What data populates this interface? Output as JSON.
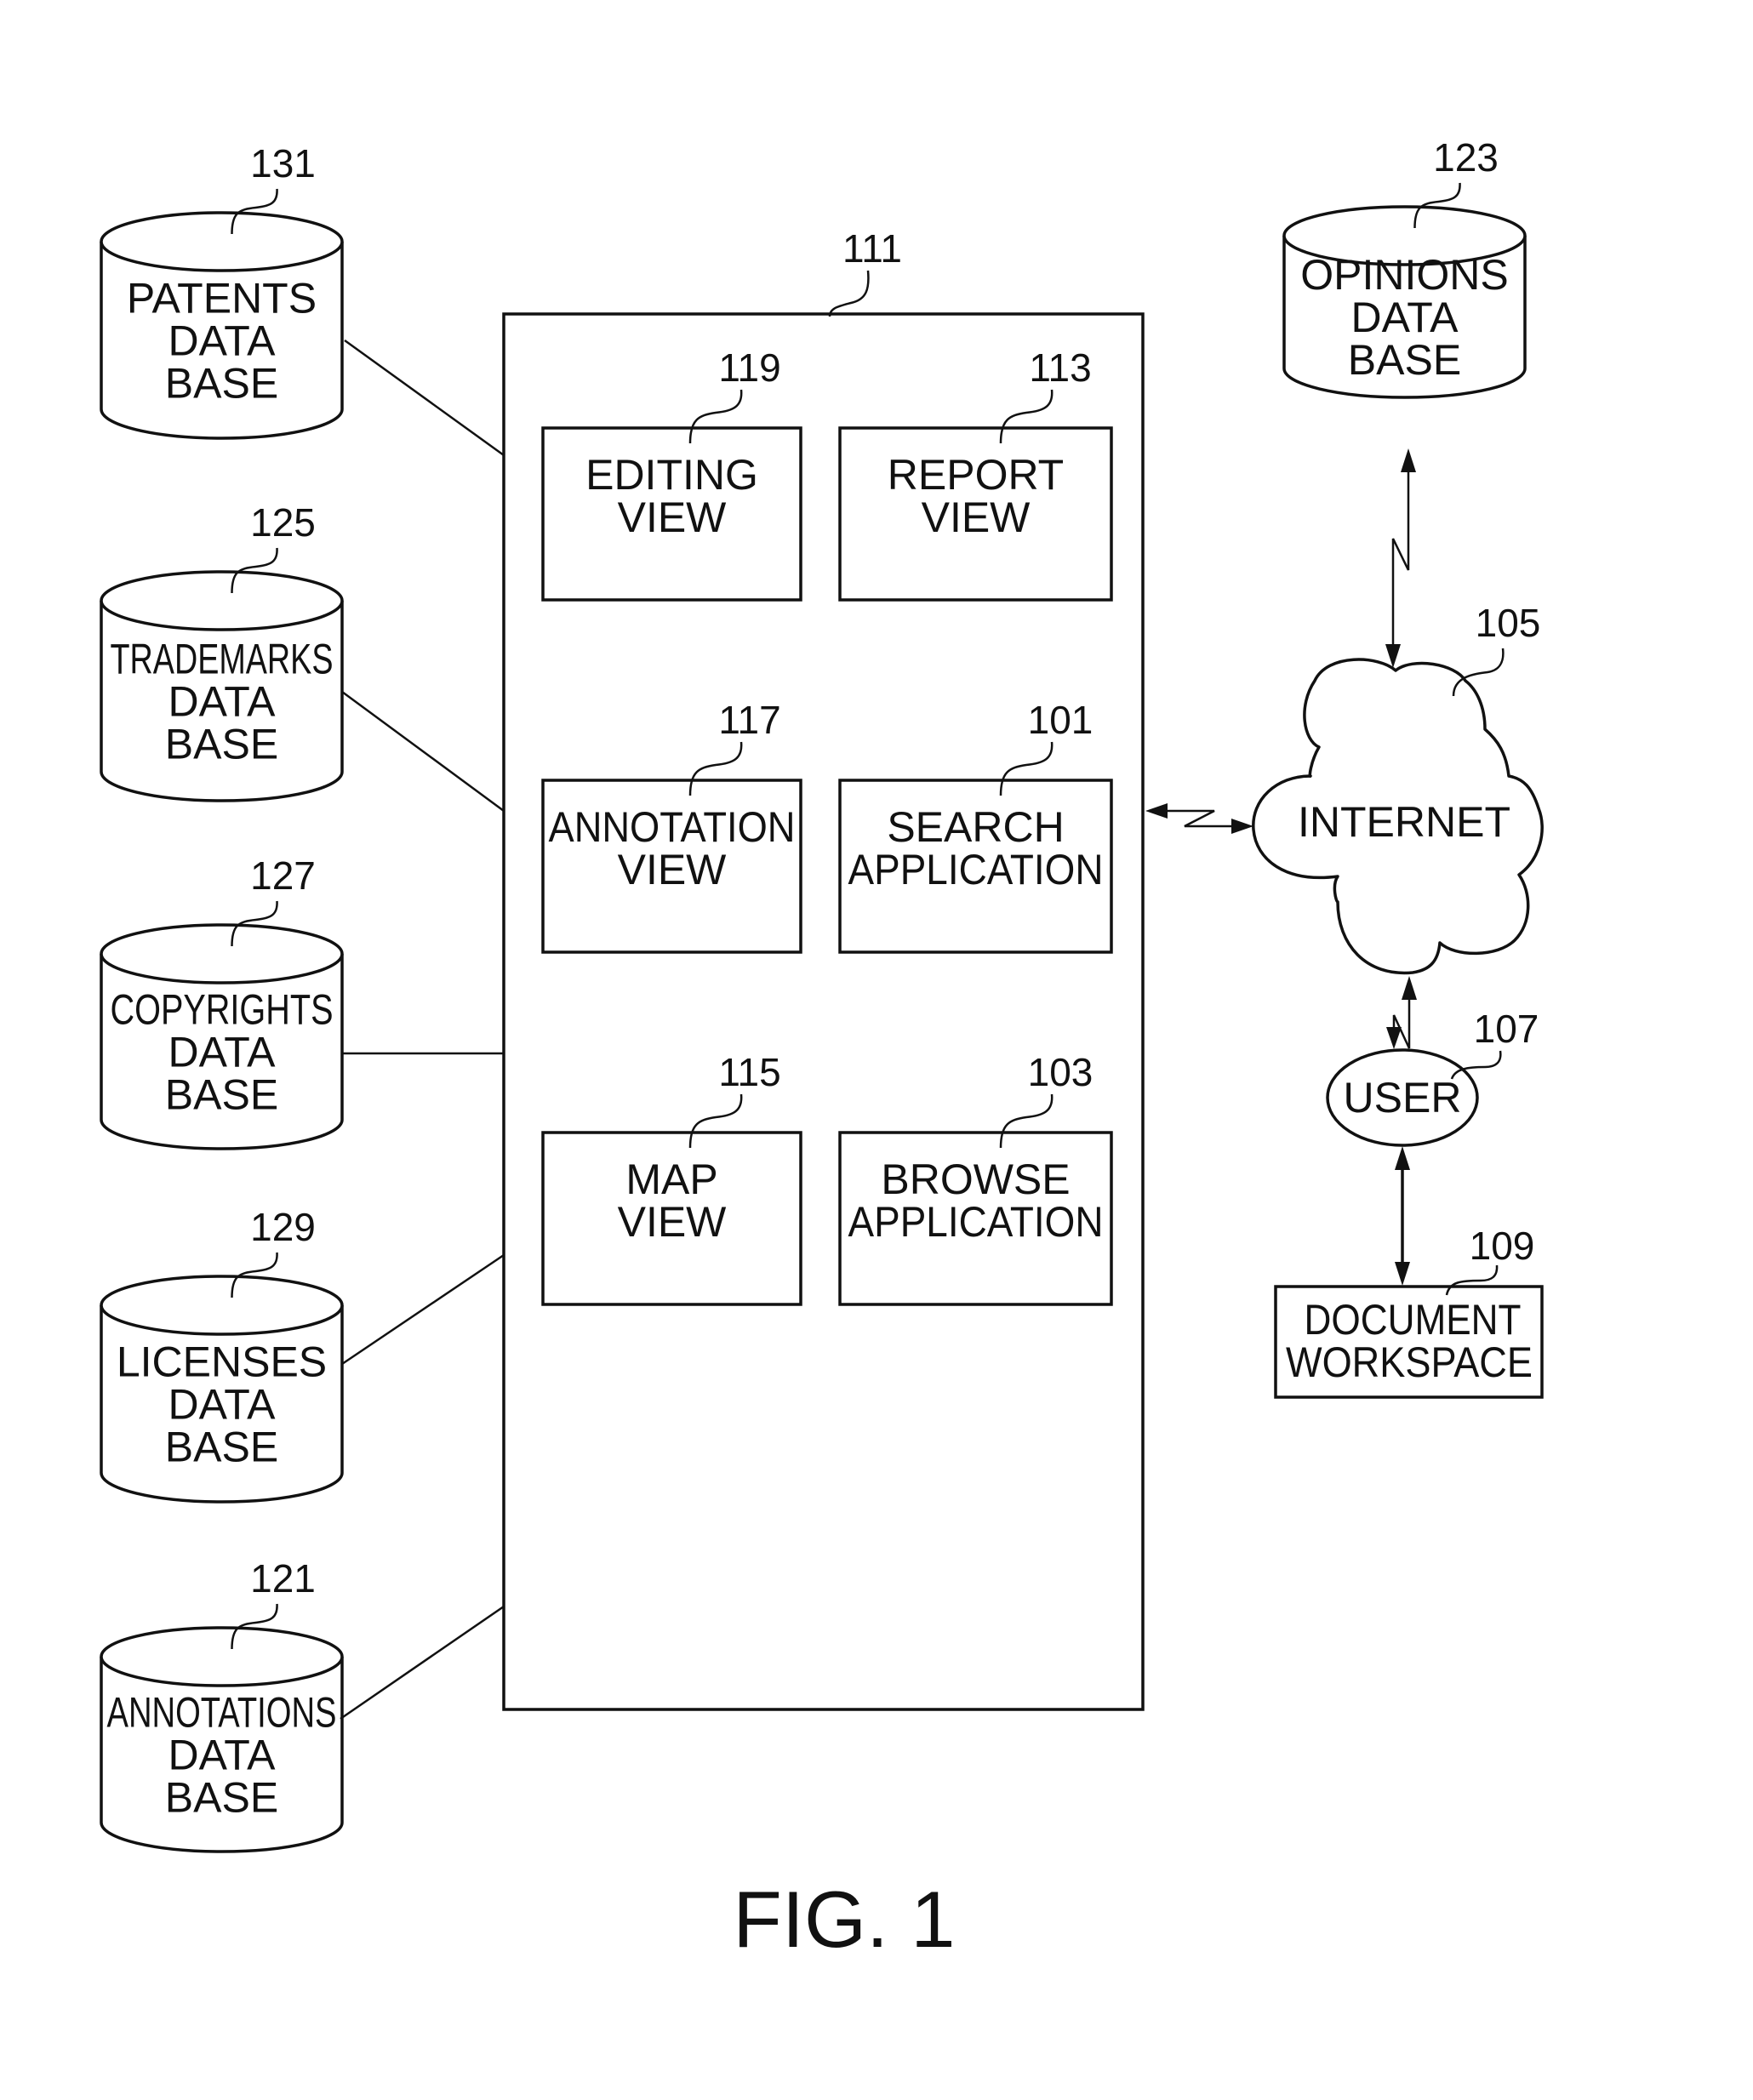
{
  "figure": {
    "caption": "FIG. 1",
    "colors": {
      "ink": "#111111",
      "paper": "#ffffff"
    }
  },
  "main_system": {
    "ref": "111",
    "modules": [
      {
        "id": "editing-view",
        "ref": "119",
        "lines": [
          "EDITING",
          "VIEW"
        ]
      },
      {
        "id": "report-view",
        "ref": "113",
        "lines": [
          "REPORT",
          "VIEW"
        ]
      },
      {
        "id": "annotation-view",
        "ref": "117",
        "lines": [
          "ANNOTATION",
          "VIEW"
        ]
      },
      {
        "id": "search-application",
        "ref": "101",
        "lines": [
          "SEARCH",
          "APPLICATION"
        ]
      },
      {
        "id": "map-view",
        "ref": "115",
        "lines": [
          "MAP",
          "VIEW"
        ]
      },
      {
        "id": "browse-application",
        "ref": "103",
        "lines": [
          "BROWSE",
          "APPLICATION"
        ]
      }
    ]
  },
  "databases": [
    {
      "id": "patents-database",
      "ref": "131",
      "lines": [
        "PATENTS",
        "DATA",
        "BASE"
      ]
    },
    {
      "id": "trademarks-database",
      "ref": "125",
      "lines": [
        "TRADEMARKS",
        "DATA",
        "BASE"
      ]
    },
    {
      "id": "copyrights-database",
      "ref": "127",
      "lines": [
        "COPYRIGHTS",
        "DATA",
        "BASE"
      ]
    },
    {
      "id": "licenses-database",
      "ref": "129",
      "lines": [
        "LICENSES",
        "DATA",
        "BASE"
      ]
    },
    {
      "id": "annotations-database",
      "ref": "121",
      "lines": [
        "ANNOTATIONS",
        "DATA",
        "BASE"
      ]
    }
  ],
  "opinions_database": {
    "ref": "123",
    "lines": [
      "OPINIONS",
      "DATA",
      "BASE"
    ]
  },
  "internet": {
    "ref": "105",
    "label": "INTERNET"
  },
  "user": {
    "ref": "107",
    "label": "USER"
  },
  "document_workspace": {
    "ref": "109",
    "lines": [
      "DOCUMENT",
      "WORKSPACE"
    ]
  },
  "connections": [
    {
      "from": "patents-database",
      "to": "main-system",
      "kind": "line"
    },
    {
      "from": "trademarks-database",
      "to": "main-system",
      "kind": "line"
    },
    {
      "from": "copyrights-database",
      "to": "main-system",
      "kind": "line"
    },
    {
      "from": "licenses-database",
      "to": "main-system",
      "kind": "line"
    },
    {
      "from": "annotations-database",
      "to": "main-system",
      "kind": "line"
    },
    {
      "from": "main-system",
      "to": "internet",
      "kind": "network-bidirectional"
    },
    {
      "from": "opinions-database",
      "to": "internet",
      "kind": "network-bidirectional"
    },
    {
      "from": "internet",
      "to": "user",
      "kind": "network-bidirectional"
    },
    {
      "from": "user",
      "to": "document-workspace",
      "kind": "bidirectional"
    }
  ]
}
